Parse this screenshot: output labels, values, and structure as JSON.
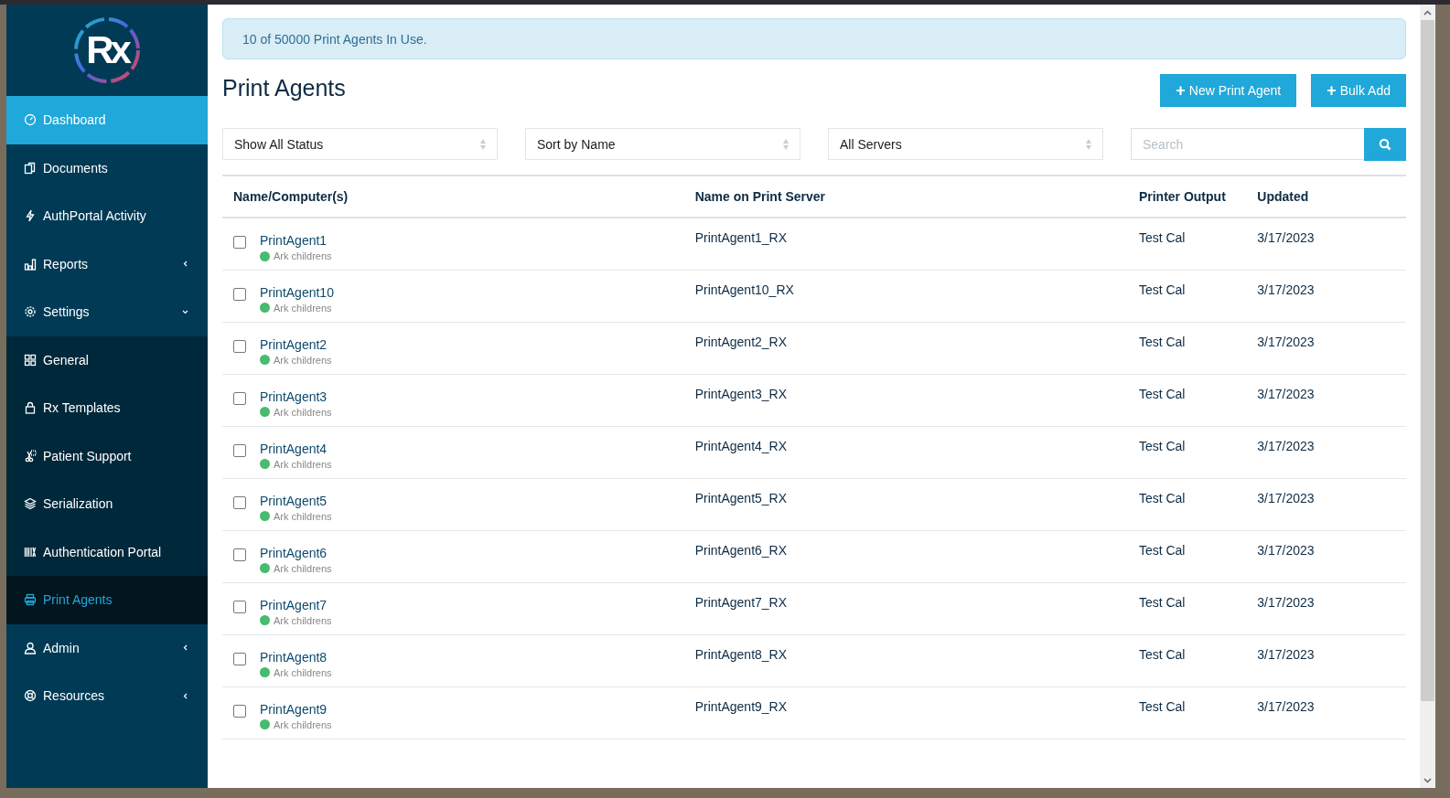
{
  "logo": {
    "text": "Rx"
  },
  "sidebar": {
    "items": [
      {
        "label": "Dashboard",
        "selected": true
      },
      {
        "label": "Documents",
        "selected": false
      },
      {
        "label": "AuthPortal Activity",
        "selected": false
      },
      {
        "label": "Reports",
        "selected": false,
        "expanded": false
      },
      {
        "label": "Settings",
        "selected": false,
        "expanded": true,
        "children": [
          {
            "label": "General",
            "selected": false
          },
          {
            "label": "Rx Templates",
            "selected": false
          },
          {
            "label": "Patient Support",
            "selected": false
          },
          {
            "label": "Serialization",
            "selected": false
          },
          {
            "label": "Authentication Portal",
            "selected": false
          },
          {
            "label": "Print Agents",
            "selected": true
          }
        ]
      },
      {
        "label": "Admin",
        "selected": false,
        "expanded": false
      },
      {
        "label": "Resources",
        "selected": false,
        "expanded": false
      }
    ]
  },
  "alert": "10 of 50000 Print Agents In Use.",
  "title": "Print Agents",
  "buttons": [
    {
      "icon": "+",
      "label": "New Print Agent"
    },
    {
      "icon": "+",
      "label": "Bulk Add"
    }
  ],
  "filters": [
    {
      "value": "Show All Status"
    },
    {
      "value": "Sort by Name"
    },
    {
      "value": "All Servers"
    }
  ],
  "search": {
    "placeholder": "Search"
  },
  "table": {
    "columns": [
      "Name/Computer(s)",
      "Name on Print Server",
      "Printer Output",
      "Updated"
    ],
    "rows": [
      {
        "checked": false,
        "name": "PrintAgent1",
        "computer": "Ark childrens",
        "color": "#48bb6e",
        "server_name": "PrintAgent1_RX",
        "output": "Test Cal",
        "updated": "3/17/2023"
      },
      {
        "checked": false,
        "name": "PrintAgent10",
        "computer": "Ark childrens",
        "color": "#48bb6e",
        "server_name": "PrintAgent10_RX",
        "output": "Test Cal",
        "updated": "3/17/2023"
      },
      {
        "checked": false,
        "name": "PrintAgent2",
        "computer": "Ark childrens",
        "color": "#48bb6e",
        "server_name": "PrintAgent2_RX",
        "output": "Test Cal",
        "updated": "3/17/2023"
      },
      {
        "checked": false,
        "name": "PrintAgent3",
        "computer": "Ark childrens",
        "color": "#48bb6e",
        "server_name": "PrintAgent3_RX",
        "output": "Test Cal",
        "updated": "3/17/2023"
      },
      {
        "checked": false,
        "name": "PrintAgent4",
        "computer": "Ark childrens",
        "color": "#48bb6e",
        "server_name": "PrintAgent4_RX",
        "output": "Test Cal",
        "updated": "3/17/2023"
      },
      {
        "checked": false,
        "name": "PrintAgent5",
        "computer": "Ark childrens",
        "color": "#48bb6e",
        "server_name": "PrintAgent5_RX",
        "output": "Test Cal",
        "updated": "3/17/2023"
      },
      {
        "checked": false,
        "name": "PrintAgent6",
        "computer": "Ark childrens",
        "color": "#48bb6e",
        "server_name": "PrintAgent6_RX",
        "output": "Test Cal",
        "updated": "3/17/2023"
      },
      {
        "checked": false,
        "name": "PrintAgent7",
        "computer": "Ark childrens",
        "color": "#48bb6e",
        "server_name": "PrintAgent7_RX",
        "output": "Test Cal",
        "updated": "3/17/2023"
      },
      {
        "checked": false,
        "name": "PrintAgent8",
        "computer": "Ark childrens",
        "color": "#48bb6e",
        "server_name": "PrintAgent8_RX",
        "output": "Test Cal",
        "updated": "3/17/2023"
      },
      {
        "checked": false,
        "name": "PrintAgent9",
        "computer": "Ark childrens",
        "color": "#48bb6e",
        "server_name": "PrintAgent9_RX",
        "output": "Test Cal",
        "updated": "3/17/2023"
      }
    ]
  }
}
